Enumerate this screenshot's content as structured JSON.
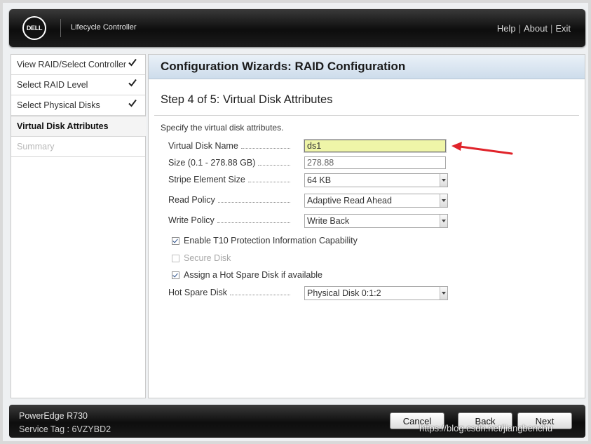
{
  "header": {
    "logo_text": "DELL",
    "product": "Lifecycle Controller",
    "links": [
      "Help",
      "About",
      "Exit"
    ],
    "separator": "|"
  },
  "nav": {
    "items": [
      {
        "label": "View RAID/Select Controller",
        "state": "done"
      },
      {
        "label": "Select RAID Level",
        "state": "done"
      },
      {
        "label": "Select Physical Disks",
        "state": "done"
      },
      {
        "label": "Virtual Disk Attributes",
        "state": "active"
      },
      {
        "label": "Summary",
        "state": "disabled"
      }
    ]
  },
  "main": {
    "title": "Configuration Wizards: RAID Configuration",
    "step": "Step 4 of 5: Virtual Disk Attributes",
    "instructions": "Specify the virtual disk attributes.",
    "fields": {
      "vd_name": {
        "label": "Virtual Disk Name",
        "value": "ds1"
      },
      "size": {
        "label": "Size (0.1 - 278.88 GB)",
        "value": "278.88"
      },
      "stripe": {
        "label": "Stripe Element Size",
        "value": "64 KB"
      },
      "read_policy": {
        "label": "Read Policy",
        "value": "Adaptive Read Ahead"
      },
      "write_policy": {
        "label": "Write Policy",
        "value": "Write Back"
      },
      "hot_spare_disk": {
        "label": "Hot Spare Disk",
        "value": "Physical Disk 0:1:2"
      }
    },
    "checkboxes": {
      "t10": {
        "label": "Enable T10 Protection Information Capability",
        "checked": true
      },
      "secure": {
        "label": "Secure Disk",
        "checked": false,
        "disabled": true
      },
      "hot_spare": {
        "label": "Assign a Hot Spare Disk if available",
        "checked": true
      }
    }
  },
  "footer": {
    "model": "PowerEdge R730",
    "service_tag": "Service Tag : 6VZYBD2",
    "buttons": {
      "cancel": "Cancel",
      "back": "Back",
      "next": "Next"
    }
  },
  "watermark": "https://blog.csdn.net/jiangbenchu",
  "colors": {
    "active_input": "#eff5a8",
    "annotation_arrow": "#e0232a",
    "title_bar": "#cddceb"
  }
}
